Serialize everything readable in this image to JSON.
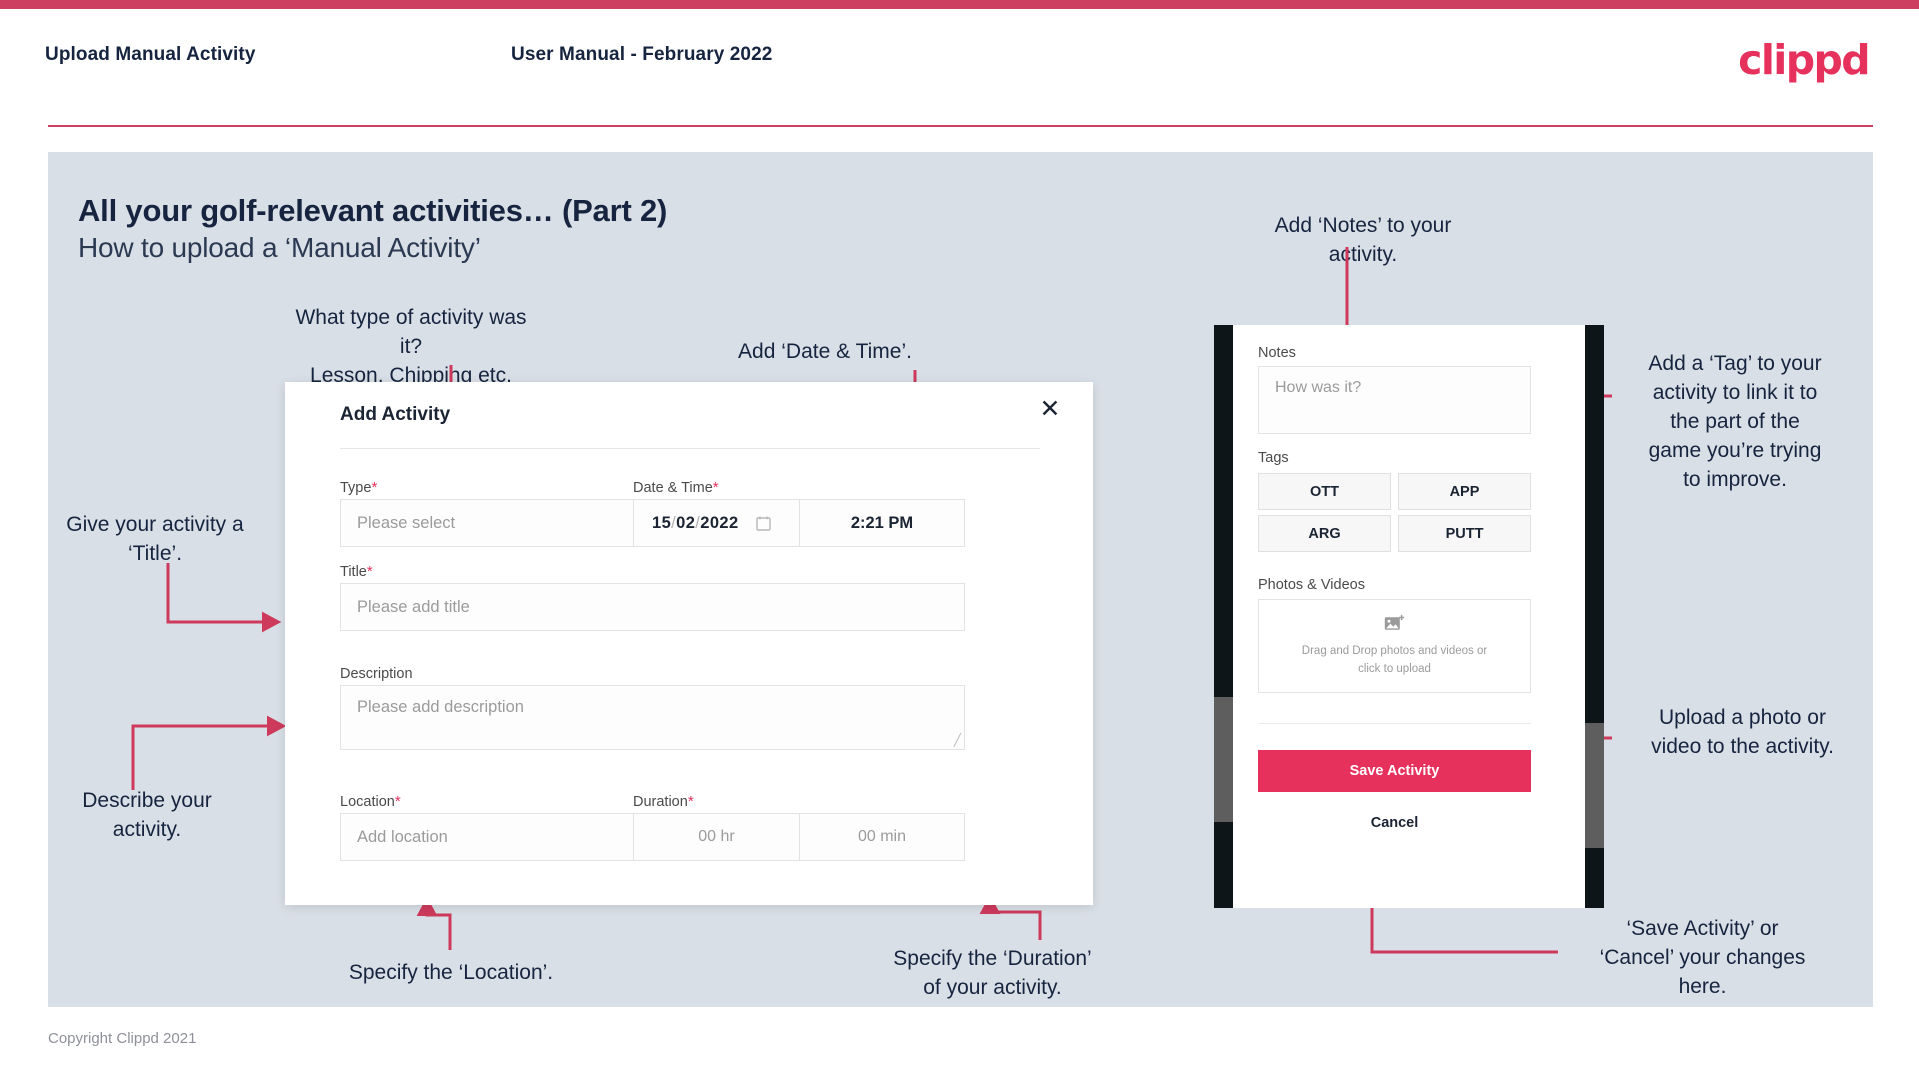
{
  "header": {
    "title": "Upload Manual Activity",
    "subtitle": "User Manual - February 2022",
    "logo": "clippd"
  },
  "slide": {
    "title": "All your golf-relevant activities… (Part 2)",
    "subtitle": "How to upload a ‘Manual Activity’"
  },
  "annotations": {
    "type": "What type of activity was it?\nLesson, Chipping etc.",
    "datetime": "Add ‘Date & Time’.",
    "title": "Give your activity a\n‘Title’.",
    "description": "Describe your\nactivity.",
    "location": "Specify the ‘Location’.",
    "duration": "Specify the ‘Duration’\nof your activity.",
    "notes": "Add ‘Notes’ to your\nactivity.",
    "tags": "Add a ‘Tag’ to your\nactivity to link it to\nthe part of the\ngame you’re trying\nto improve.",
    "upload": "Upload a photo or\nvideo to the activity.",
    "save": "‘Save Activity’ or\n‘Cancel’ your changes\nhere."
  },
  "dialog": {
    "title": "Add Activity",
    "close_icon": "close-icon",
    "fields": {
      "type": {
        "label": "Type",
        "required": "*",
        "placeholder": "Please select",
        "chevron_icon": "chevron-down-icon"
      },
      "datetime": {
        "label": "Date & Time",
        "required": "*",
        "day": "15",
        "month": "02",
        "year": "2022",
        "sep": "/",
        "calendar_icon": "calendar-icon",
        "time": "2:21 PM"
      },
      "title": {
        "label": "Title",
        "required": "*",
        "placeholder": "Please add title"
      },
      "description": {
        "label": "Description",
        "required": "",
        "placeholder": "Please add description"
      },
      "location": {
        "label": "Location",
        "required": "*",
        "placeholder": "Add location"
      },
      "duration": {
        "label": "Duration",
        "required": "*",
        "hours_placeholder": "00 hr",
        "minutes_placeholder": "00 min"
      }
    }
  },
  "phone": {
    "notes": {
      "label": "Notes",
      "placeholder": "How was it?"
    },
    "tags": {
      "label": "Tags",
      "items": [
        "OTT",
        "APP",
        "ARG",
        "PUTT"
      ]
    },
    "photos": {
      "label": "Photos & Videos",
      "icon": "image-add-icon",
      "drop_text": "Drag and Drop photos and videos or\nclick to upload"
    },
    "save_label": "Save Activity",
    "cancel_label": "Cancel"
  },
  "footer": {
    "copyright": "Copyright Clippd 2021"
  },
  "colors": {
    "accent": "#e5315c",
    "arrow": "#cd3a5c",
    "slide_bg": "#d9dfe6",
    "ink": "#16243f",
    "top_bar": "#cd4060"
  }
}
